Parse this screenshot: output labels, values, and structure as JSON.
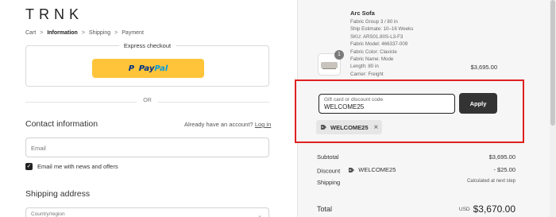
{
  "store": {
    "name": "TRNK"
  },
  "breadcrumb": {
    "items": [
      "Cart",
      "Information",
      "Shipping",
      "Payment"
    ],
    "separator": ">"
  },
  "express": {
    "label": "Express checkout",
    "paypal": {
      "word1": "Pay",
      "word2": "Pal",
      "icon": "P"
    }
  },
  "divider": {
    "label": "OR"
  },
  "contact": {
    "title": "Contact information",
    "login_prompt": "Already have an account?",
    "login_link": "Log in",
    "email_placeholder": "Email",
    "newsletter_label": "Email me with news and offers",
    "newsletter_checked": true
  },
  "shipping": {
    "title": "Shipping address",
    "country_placeholder": "Country/region"
  },
  "product": {
    "name": "Arc Sofa",
    "quantity": "1",
    "price": "$3,695.00",
    "details": [
      "Fabric Group 3 / 80 in",
      "Ship Estimate: 10–16 Weeks",
      "SKU: ARS01.80S-L3-F3",
      "Fabric Model: 466337-009",
      "Fabric Color: Clavicle",
      "Fabric Name: Mode",
      "Length: 80 in",
      "Carrier: Freight"
    ]
  },
  "discount": {
    "label": "Gift card or discount code",
    "value": "WELCOME25",
    "apply_label": "Apply",
    "applied_code": "WELCOME25",
    "remove_icon": "×"
  },
  "summary": {
    "subtotal_label": "Subtotal",
    "subtotal_value": "$3,695.00",
    "discount_label": "Discount",
    "discount_code": "WELCOME25",
    "discount_value": "- $25.00",
    "shipping_label": "Shipping",
    "shipping_value": "Calculated at next step",
    "total_label": "Total",
    "total_currency": "USD",
    "total_value": "$3,670.00"
  },
  "colors": {
    "highlight": "#e02020",
    "paypal_yellow": "#ffc439",
    "apply_button": "#333333"
  }
}
